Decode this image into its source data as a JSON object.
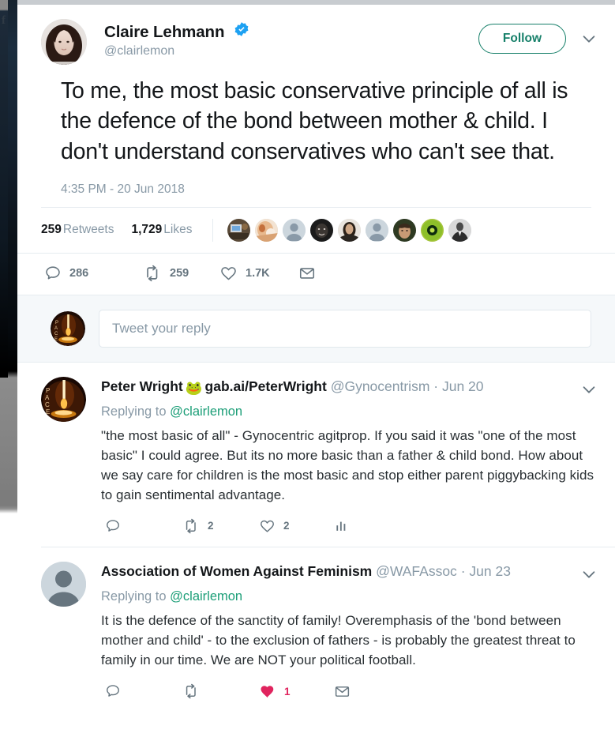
{
  "browser": {
    "left_strip_icon": "facebook-f-icon"
  },
  "tweet": {
    "display_name": "Claire Lehmann",
    "verified_icon": "verified-badge-icon",
    "handle": "@clairlemon",
    "follow_label": "Follow",
    "caret_icon": "chevron-down-icon",
    "text": "To me, the most basic conservative principle of all is the defence of the bond between mother & child. I don't understand conservatives who can't see that.",
    "timestamp": "4:35 PM - 20 Jun 2018",
    "stats": {
      "retweets_count": "259",
      "retweets_label": "Retweets",
      "likes_count": "1,729",
      "likes_label": "Likes"
    },
    "facepile_count": 9,
    "actions": {
      "reply_icon": "reply-bubble-icon",
      "reply_count": "286",
      "retweet_icon": "retweet-icon",
      "retweet_count": "259",
      "like_icon": "heart-outline-icon",
      "like_count": "1.7K",
      "share_icon": "envelope-icon"
    },
    "accent_follow_color": "#17806a",
    "verified_color": "#1da1f2",
    "like_red": "#e0245e"
  },
  "composer": {
    "placeholder": "Tweet your reply",
    "value": "",
    "avatar_icon": "candle-avatar"
  },
  "replies": [
    {
      "avatar_icon": "candle-avatar",
      "name": "Peter Wright",
      "emoji": "🐸",
      "name_suffix": "gab.ai/PeterWright",
      "handle": "@Gynocentrism",
      "separator": "·",
      "date": "Jun 20",
      "caret_icon": "chevron-down-icon",
      "replying_to_label": "Replying to",
      "replying_to_mention": "@clairlemon",
      "text": "\"the most basic of all\" - Gynocentric agitprop. If you said it was \"one of the most basic\" I could agree. But its no more basic than a father & child bond. How about we say care for children is the most basic and stop either parent piggybacking kids to gain sentimental advantage.",
      "actions": {
        "reply_icon": "reply-bubble-icon",
        "reply_count": "",
        "retweet_icon": "retweet-icon",
        "retweet_count": "2",
        "like_icon": "heart-outline-icon",
        "like_count": "2",
        "liked": false,
        "last_icon": "analytics-bars-icon"
      }
    },
    {
      "avatar_icon": "default-person-avatar",
      "name": "Association of Women Against Feminism",
      "emoji": "",
      "name_suffix": "",
      "handle": "@WAFAssoc",
      "separator": "·",
      "date": "Jun 23",
      "caret_icon": "chevron-down-icon",
      "replying_to_label": "Replying to",
      "replying_to_mention": "@clairlemon",
      "text": "It is the defence of the sanctity of family! Overemphasis of the 'bond between mother and child' - to the exclusion of fathers - is probably the greatest threat to family in our time. We are NOT your political football.",
      "actions": {
        "reply_icon": "reply-bubble-icon",
        "reply_count": "",
        "retweet_icon": "retweet-icon",
        "retweet_count": "",
        "like_icon": "heart-filled-icon",
        "like_count": "1",
        "liked": true,
        "last_icon": "envelope-icon"
      }
    }
  ]
}
